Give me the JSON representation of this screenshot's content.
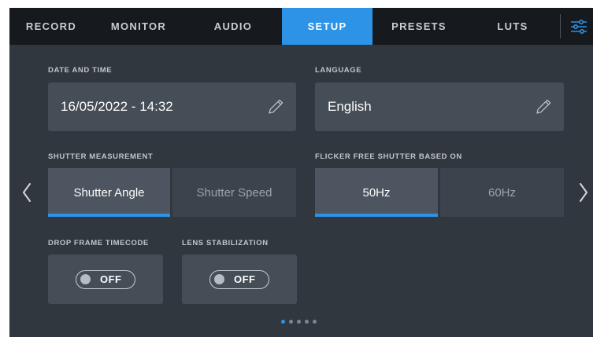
{
  "tabs": [
    {
      "label": "RECORD",
      "active": false
    },
    {
      "label": "MONITOR",
      "active": false
    },
    {
      "label": "AUDIO",
      "active": false
    },
    {
      "label": "SETUP",
      "active": true
    },
    {
      "label": "PRESETS",
      "active": false
    },
    {
      "label": "LUTS",
      "active": false
    }
  ],
  "menu_icon": "sliders-icon",
  "date_time": {
    "label": "DATE AND TIME",
    "value": "16/05/2022 - 14:32",
    "edit_icon": "pencil-icon"
  },
  "language": {
    "label": "LANGUAGE",
    "value": "English",
    "edit_icon": "pencil-icon"
  },
  "shutter_measurement": {
    "label": "SHUTTER MEASUREMENT",
    "options": [
      "Shutter Angle",
      "Shutter Speed"
    ],
    "selected": "Shutter Angle"
  },
  "flicker_free": {
    "label": "FLICKER FREE SHUTTER BASED ON",
    "options": [
      "50Hz",
      "60Hz"
    ],
    "selected": "50Hz"
  },
  "drop_frame_timecode": {
    "label": "DROP FRAME TIMECODE",
    "state": "OFF"
  },
  "lens_stabilization": {
    "label": "LENS STABILIZATION",
    "state": "OFF"
  },
  "navigation": {
    "prev_icon": "chevron-left-icon",
    "next_icon": "chevron-right-icon"
  },
  "pagination": {
    "pages": 5,
    "current": 1
  },
  "colors": {
    "accent": "#2d93e6",
    "panel": "#30373f",
    "tabbar": "#16191d",
    "card": "#454d57"
  }
}
